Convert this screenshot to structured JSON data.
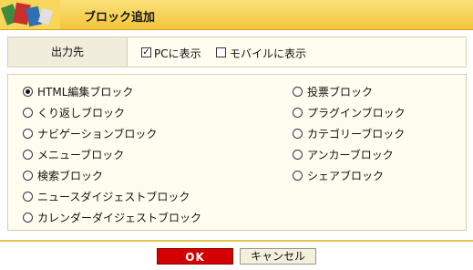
{
  "header": {
    "title": "ブロック追加"
  },
  "destination": {
    "label": "出力先",
    "options": [
      {
        "label": "PCに表示",
        "checked": true
      },
      {
        "label": "モバイルに表示",
        "checked": false
      }
    ]
  },
  "blocks": {
    "selected": "HTML編集ブロック",
    "left": [
      "HTML編集ブロック",
      "くり返しブロック",
      "ナビゲーションブロック",
      "メニューブロック",
      "検索ブロック",
      "ニュースダイジェストブロック",
      "カレンダーダイジェストブロック"
    ],
    "right": [
      "投票ブロック",
      "プラグインブロック",
      "カテゴリーブロック",
      "アンカーブロック",
      "シェアブロック"
    ]
  },
  "buttons": {
    "ok": "OK",
    "cancel": "キャンセル"
  },
  "colors": {
    "ok_bg": "#d40000",
    "header": "#f2c53a"
  }
}
